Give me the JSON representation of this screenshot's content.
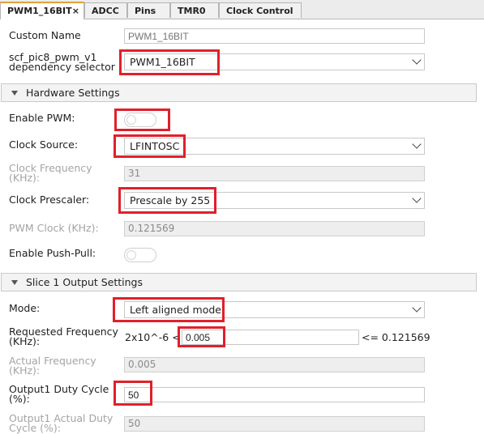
{
  "tabs": [
    {
      "label": "PWM1_16BIT",
      "close": "×"
    },
    {
      "label": "ADCC"
    },
    {
      "label": "Pins"
    },
    {
      "label": "TMR0"
    },
    {
      "label": "Clock Control"
    }
  ],
  "custom_name": {
    "label": "Custom Name",
    "placeholder": "PWM1_16BIT"
  },
  "dependency_selector": {
    "label_line1": "scf_pic8_pwm_v1",
    "label_line2": "dependency selector",
    "value": "PWM1_16BIT"
  },
  "hardware_settings": {
    "title": "Hardware Settings",
    "enable_pwm": {
      "label": "Enable PWM:",
      "on": false
    },
    "clock_source": {
      "label": "Clock Source:",
      "value": "LFINTOSC"
    },
    "clock_frequency": {
      "label_line1": "Clock Frequency",
      "label_line2": "(KHz):",
      "value": "31"
    },
    "clock_prescaler": {
      "label": "Clock Prescaler:",
      "value": "Prescale by 255"
    },
    "pwm_clock": {
      "label": "PWM Clock (KHz):",
      "value": "0.121569"
    },
    "enable_push_pull": {
      "label": "Enable Push-Pull:",
      "on": false
    }
  },
  "slice1": {
    "title": "Slice 1 Output Settings",
    "mode": {
      "label": "Mode:",
      "value": "Left aligned mode"
    },
    "requested_frequency": {
      "label_line1": "Requested Frequency",
      "label_line2": "(KHz):",
      "lower_bound": "2x10^-6 <",
      "value": "0.005",
      "upper_bound": "<= 0.121569"
    },
    "actual_frequency": {
      "label_line1": "Actual Frequency",
      "label_line2": "(KHz):",
      "value": "0.005"
    },
    "duty_cycle": {
      "label_line1": "Output1 Duty Cycle",
      "label_line2": "(%):",
      "value": "50"
    },
    "actual_duty_cycle": {
      "label_line1": "Output1 Actual Duty",
      "label_line2": "Cycle (%):",
      "value": "50"
    }
  }
}
